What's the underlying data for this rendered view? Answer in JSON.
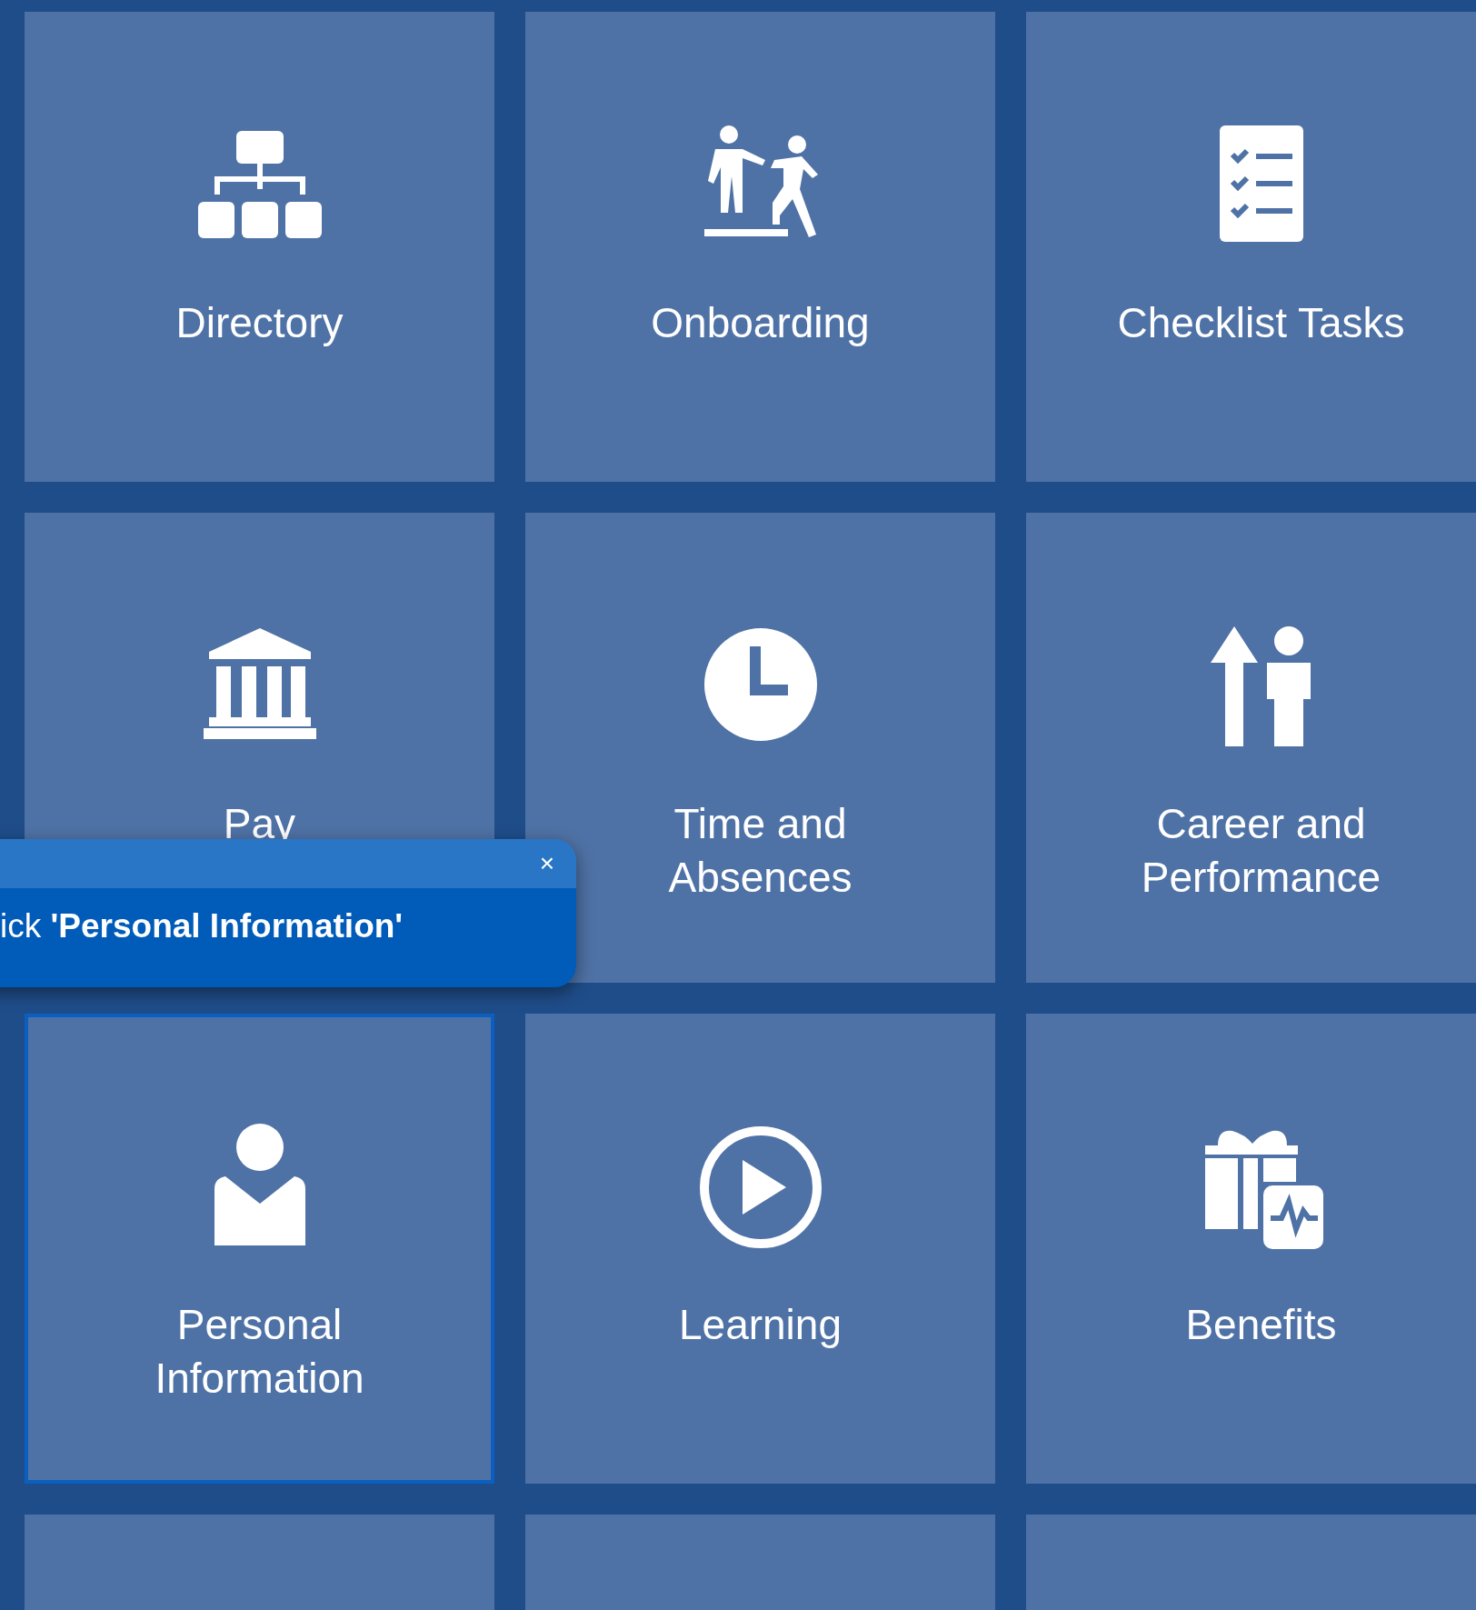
{
  "tiles": [
    {
      "label": "Directory",
      "selected": false
    },
    {
      "label": "Onboarding",
      "selected": false
    },
    {
      "label": "Checklist Tasks",
      "selected": false
    },
    {
      "label": "Pay",
      "selected": false
    },
    {
      "label": "Time and Absences",
      "selected": false
    },
    {
      "label": "Career and Performance",
      "selected": false
    },
    {
      "label": "Personal Information",
      "selected": true
    },
    {
      "label": "Learning",
      "selected": false
    },
    {
      "label": "Benefits",
      "selected": false
    }
  ],
  "guide_tip": {
    "text": "ick **'Personal Information'**",
    "close": "×"
  }
}
